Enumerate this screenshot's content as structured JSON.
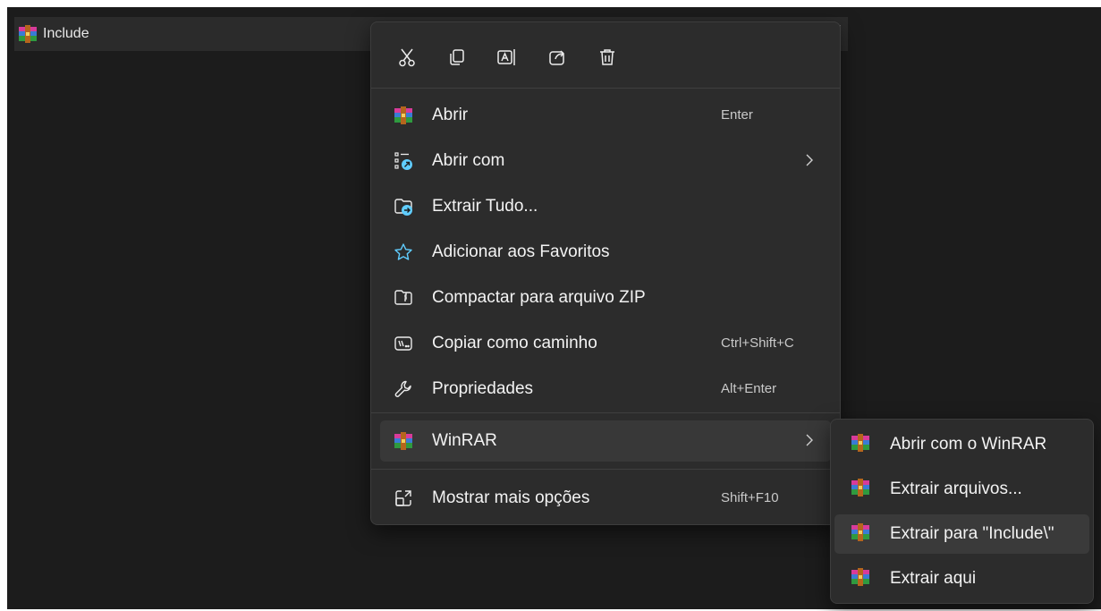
{
  "file": {
    "name": "Include"
  },
  "toolbar": {
    "icons": [
      "cut-icon",
      "copy-icon",
      "rename-icon",
      "share-icon",
      "delete-icon"
    ]
  },
  "menu": {
    "items": [
      {
        "label": "Abrir",
        "shortcut": "Enter",
        "icon": "winrar-icon"
      },
      {
        "label": "Abrir com",
        "shortcut": "",
        "icon": "open-with-icon",
        "submenu": true
      },
      {
        "label": "Extrair Tudo...",
        "shortcut": "",
        "icon": "extract-all-icon"
      },
      {
        "label": "Adicionar aos Favoritos",
        "shortcut": "",
        "icon": "star-icon"
      },
      {
        "label": "Compactar para arquivo ZIP",
        "shortcut": "",
        "icon": "zip-icon"
      },
      {
        "label": "Copiar como caminho",
        "shortcut": "Ctrl+Shift+C",
        "icon": "copy-path-icon"
      },
      {
        "label": "Propriedades",
        "shortcut": "Alt+Enter",
        "icon": "wrench-icon"
      }
    ],
    "winrar": {
      "label": "WinRAR"
    },
    "more": {
      "label": "Mostrar mais opções",
      "shortcut": "Shift+F10"
    }
  },
  "submenu": {
    "items": [
      {
        "label": "Abrir com o WinRAR"
      },
      {
        "label": "Extrair arquivos..."
      },
      {
        "label": "Extrair para \"Include\\\""
      },
      {
        "label": "Extrair aqui"
      }
    ]
  },
  "colors": {
    "background": "#1c1c1c",
    "menu": "#2c2c2c",
    "hover": "#383838",
    "text": "#f3f3f3",
    "accent": "#60cdff"
  }
}
